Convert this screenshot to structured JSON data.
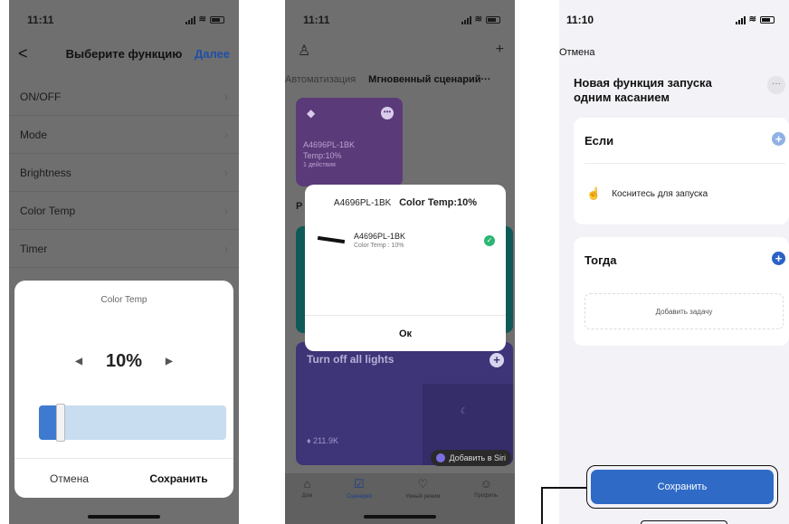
{
  "phone1": {
    "time": "11:11",
    "nav": {
      "back": "<",
      "title": "Выберите функцию",
      "next": "Далее"
    },
    "rows": [
      "ON/OFF",
      "Mode",
      "Brightness",
      "Color Temp",
      "Timer"
    ],
    "sheet": {
      "title": "Color Temp",
      "value": "10%",
      "level_percent": 10,
      "cancel": "Отмена",
      "save": "Сохранить"
    }
  },
  "phone2": {
    "time": "11:11",
    "tabs": {
      "automation": "Автоматизация",
      "instant": "Мгновенный сценарий···"
    },
    "card_small": {
      "line1": "A4696PL-1BK",
      "line2": "Temp:10%",
      "line3": "1 действия"
    },
    "section_label": "Р",
    "card_big": {
      "name": "Turn off all lights",
      "count": "211.9K"
    },
    "siri": "Добавить в Siri",
    "dialog": {
      "device_header": "A4696PL-1BK",
      "setting_header": "Color Temp:10%",
      "device_name": "A4696PL-1BK",
      "device_detail": "Color Temp : 10%",
      "ok": "Ок"
    },
    "tabbar": [
      "Дом",
      "Сценарий",
      "Умный режим",
      "Профиль"
    ]
  },
  "phone3": {
    "time": "11:10",
    "cancel": "Отмена",
    "title": "Новая функция запуска одним касанием",
    "if_header": "Если",
    "trigger": "Коснитесь для запуска",
    "then_header": "Тогда",
    "add_task": "Добавить задачу",
    "save": "Сохранить"
  },
  "colors": {
    "accent_blue": "#2f6bc6",
    "purple_card": "#5b3a7a",
    "teal_card": "#0f5a57",
    "indigo_card": "#3d3577",
    "success_green": "#2bb673"
  }
}
